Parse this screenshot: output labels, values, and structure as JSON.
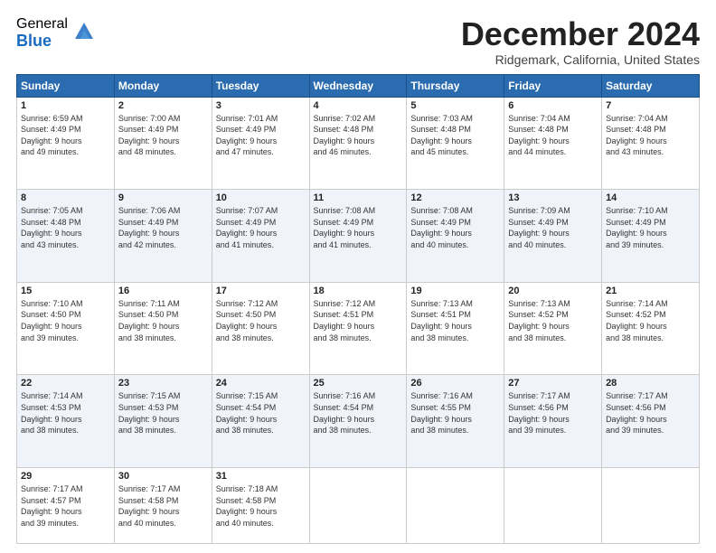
{
  "header": {
    "logo_general": "General",
    "logo_blue": "Blue",
    "month_title": "December 2024",
    "location": "Ridgemark, California, United States"
  },
  "days_of_week": [
    "Sunday",
    "Monday",
    "Tuesday",
    "Wednesday",
    "Thursday",
    "Friday",
    "Saturday"
  ],
  "weeks": [
    [
      {
        "day": "1",
        "sunrise": "6:59 AM",
        "sunset": "4:49 PM",
        "daylight": "9 hours and 49 minutes."
      },
      {
        "day": "2",
        "sunrise": "7:00 AM",
        "sunset": "4:49 PM",
        "daylight": "9 hours and 48 minutes."
      },
      {
        "day": "3",
        "sunrise": "7:01 AM",
        "sunset": "4:49 PM",
        "daylight": "9 hours and 47 minutes."
      },
      {
        "day": "4",
        "sunrise": "7:02 AM",
        "sunset": "4:48 PM",
        "daylight": "9 hours and 46 minutes."
      },
      {
        "day": "5",
        "sunrise": "7:03 AM",
        "sunset": "4:48 PM",
        "daylight": "9 hours and 45 minutes."
      },
      {
        "day": "6",
        "sunrise": "7:04 AM",
        "sunset": "4:48 PM",
        "daylight": "9 hours and 44 minutes."
      },
      {
        "day": "7",
        "sunrise": "7:04 AM",
        "sunset": "4:48 PM",
        "daylight": "9 hours and 43 minutes."
      }
    ],
    [
      {
        "day": "8",
        "sunrise": "7:05 AM",
        "sunset": "4:48 PM",
        "daylight": "9 hours and 43 minutes."
      },
      {
        "day": "9",
        "sunrise": "7:06 AM",
        "sunset": "4:49 PM",
        "daylight": "9 hours and 42 minutes."
      },
      {
        "day": "10",
        "sunrise": "7:07 AM",
        "sunset": "4:49 PM",
        "daylight": "9 hours and 41 minutes."
      },
      {
        "day": "11",
        "sunrise": "7:08 AM",
        "sunset": "4:49 PM",
        "daylight": "9 hours and 41 minutes."
      },
      {
        "day": "12",
        "sunrise": "7:08 AM",
        "sunset": "4:49 PM",
        "daylight": "9 hours and 40 minutes."
      },
      {
        "day": "13",
        "sunrise": "7:09 AM",
        "sunset": "4:49 PM",
        "daylight": "9 hours and 40 minutes."
      },
      {
        "day": "14",
        "sunrise": "7:10 AM",
        "sunset": "4:49 PM",
        "daylight": "9 hours and 39 minutes."
      }
    ],
    [
      {
        "day": "15",
        "sunrise": "7:10 AM",
        "sunset": "4:50 PM",
        "daylight": "9 hours and 39 minutes."
      },
      {
        "day": "16",
        "sunrise": "7:11 AM",
        "sunset": "4:50 PM",
        "daylight": "9 hours and 38 minutes."
      },
      {
        "day": "17",
        "sunrise": "7:12 AM",
        "sunset": "4:50 PM",
        "daylight": "9 hours and 38 minutes."
      },
      {
        "day": "18",
        "sunrise": "7:12 AM",
        "sunset": "4:51 PM",
        "daylight": "9 hours and 38 minutes."
      },
      {
        "day": "19",
        "sunrise": "7:13 AM",
        "sunset": "4:51 PM",
        "daylight": "9 hours and 38 minutes."
      },
      {
        "day": "20",
        "sunrise": "7:13 AM",
        "sunset": "4:52 PM",
        "daylight": "9 hours and 38 minutes."
      },
      {
        "day": "21",
        "sunrise": "7:14 AM",
        "sunset": "4:52 PM",
        "daylight": "9 hours and 38 minutes."
      }
    ],
    [
      {
        "day": "22",
        "sunrise": "7:14 AM",
        "sunset": "4:53 PM",
        "daylight": "9 hours and 38 minutes."
      },
      {
        "day": "23",
        "sunrise": "7:15 AM",
        "sunset": "4:53 PM",
        "daylight": "9 hours and 38 minutes."
      },
      {
        "day": "24",
        "sunrise": "7:15 AM",
        "sunset": "4:54 PM",
        "daylight": "9 hours and 38 minutes."
      },
      {
        "day": "25",
        "sunrise": "7:16 AM",
        "sunset": "4:54 PM",
        "daylight": "9 hours and 38 minutes."
      },
      {
        "day": "26",
        "sunrise": "7:16 AM",
        "sunset": "4:55 PM",
        "daylight": "9 hours and 38 minutes."
      },
      {
        "day": "27",
        "sunrise": "7:17 AM",
        "sunset": "4:56 PM",
        "daylight": "9 hours and 39 minutes."
      },
      {
        "day": "28",
        "sunrise": "7:17 AM",
        "sunset": "4:56 PM",
        "daylight": "9 hours and 39 minutes."
      }
    ],
    [
      {
        "day": "29",
        "sunrise": "7:17 AM",
        "sunset": "4:57 PM",
        "daylight": "9 hours and 39 minutes."
      },
      {
        "day": "30",
        "sunrise": "7:17 AM",
        "sunset": "4:58 PM",
        "daylight": "9 hours and 40 minutes."
      },
      {
        "day": "31",
        "sunrise": "7:18 AM",
        "sunset": "4:58 PM",
        "daylight": "9 hours and 40 minutes."
      },
      null,
      null,
      null,
      null
    ]
  ]
}
